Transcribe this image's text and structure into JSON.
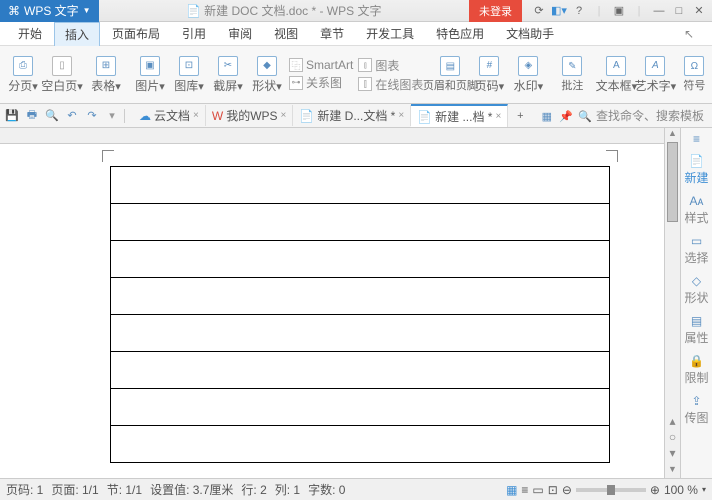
{
  "titlebar": {
    "app": "WPS 文字",
    "doc": "新建 DOC 文档.doc * - WPS 文字",
    "login": "未登录"
  },
  "menu": {
    "items": [
      "开始",
      "插入",
      "页面布局",
      "引用",
      "审阅",
      "视图",
      "章节",
      "开发工具",
      "特色应用",
      "文档助手"
    ],
    "active": 1
  },
  "ribbon": {
    "page_break": "分页",
    "blank_page": "空白页",
    "table": "表格",
    "picture": "图片",
    "gallery": "图库",
    "screenshot": "截屏",
    "shapes": "形状",
    "smartart": "SmartArt",
    "chart": "图表",
    "relation": "关系图",
    "online_pic": "在线图表",
    "header_footer": "页眉和页脚",
    "page_num": "页码",
    "watermark": "水印",
    "comment": "批注",
    "text_box": "文本框",
    "wordart": "艺术字",
    "symbol": "符号"
  },
  "tabs": {
    "items": [
      {
        "label": "云文档",
        "icon": "cloud",
        "color": "#3d8ed4"
      },
      {
        "label": "我的WPS",
        "icon": "w",
        "color": "#d94b3f"
      },
      {
        "label": "新建 D...文档 *",
        "icon": "doc",
        "color": "#3d8ed4"
      },
      {
        "label": "新建 ...档 *",
        "icon": "doc",
        "color": "#3d8ed4",
        "active": true
      }
    ],
    "search": "查找命令、搜索模板"
  },
  "sidepanel": {
    "items": [
      {
        "label": "新建",
        "icon": "📄"
      },
      {
        "label": "样式",
        "icon": "Aᴀ"
      },
      {
        "label": "选择",
        "icon": "▭"
      },
      {
        "label": "形状",
        "icon": "◇"
      },
      {
        "label": "属性",
        "icon": "▤"
      },
      {
        "label": "限制",
        "icon": "🔒"
      },
      {
        "label": "传图",
        "icon": "⇪"
      }
    ]
  },
  "statusbar": {
    "page": "页码: 1",
    "pages": "页面: 1/1",
    "section": "节: 1/1",
    "setval": "设置值: 3.7厘米",
    "row": "行: 2",
    "col": "列: 1",
    "words": "字数: 0",
    "zoom": "100 %"
  },
  "table": {
    "rows": 8,
    "cols": 1
  }
}
